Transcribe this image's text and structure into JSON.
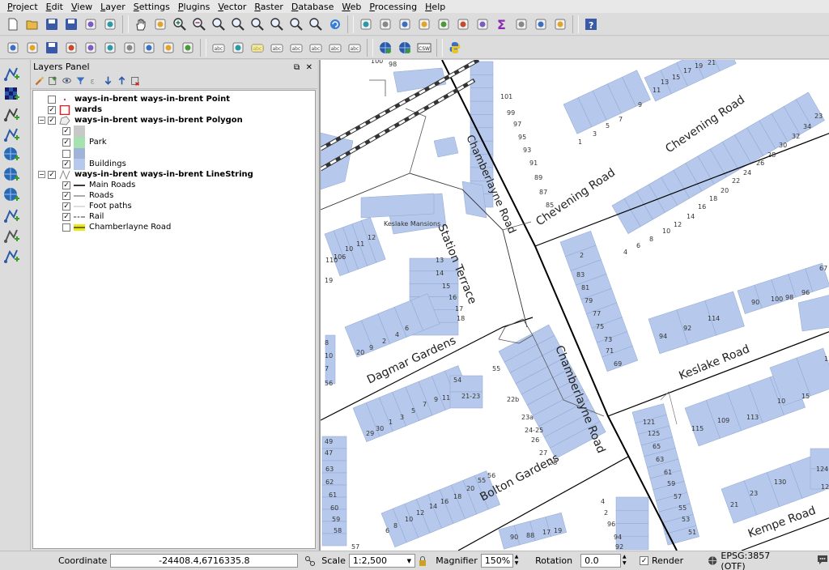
{
  "menu": [
    "Project",
    "Edit",
    "View",
    "Layer",
    "Settings",
    "Plugins",
    "Vector",
    "Raster",
    "Database",
    "Web",
    "Processing",
    "Help"
  ],
  "toolbar1": [
    "new-project-icon",
    "open-project-icon",
    "save-project-icon",
    "save-as-icon",
    "new-print-layout-icon",
    "print-composer-manager-icon",
    "|",
    "pan-icon",
    "pan-to-selection-icon",
    "zoom-in-icon",
    "zoom-out-icon",
    "zoom-actual-icon",
    "zoom-full-icon",
    "zoom-to-selection-icon",
    "zoom-to-layer-icon",
    "zoom-last-icon",
    "zoom-next-icon",
    "refresh-icon",
    "|",
    "identify-icon",
    "select-features-icon",
    "select-polygon-icon",
    "deselect-icon",
    "field-calculator-icon",
    "attribute-table-icon",
    "statistics-icon",
    "sum-icon",
    "measure-icon",
    "map-tips-icon",
    "text-annotation-icon",
    "|",
    "help-icon"
  ],
  "toolbar2": [
    "toggle-editing-icon",
    "current-edits-icon",
    "save-edits-icon",
    "add-feature-icon",
    "move-feature-icon",
    "node-tool-icon",
    "delete-selected-icon",
    "cut-features-icon",
    "copy-features-icon",
    "paste-features-icon",
    "|",
    "label-tool-icon",
    "style-manager-icon",
    "layer-labeling-icon",
    "pin-labels-icon",
    "highlight-labels-icon",
    "move-label-icon",
    "rotate-label-icon",
    "change-label-icon",
    "|",
    "metasearch-icon",
    "wms-search-icon",
    "csw-icon",
    "|",
    "python-console-icon"
  ],
  "sidebar_tools": [
    "add-vector-layer-icon",
    "add-raster-layer-icon",
    "add-spatialite-layer-icon",
    "add-postgis-layer-icon",
    "add-wms-layer-icon",
    "add-wfs-layer-icon",
    "add-wcs-layer-icon",
    "add-delimited-text-icon",
    "add-gpx-layer-icon",
    "new-shapefile-icon"
  ],
  "layers_panel": {
    "title": "Layers Panel",
    "layers": [
      {
        "name": "ways-in-brent ways-in-brent Point",
        "checked": false,
        "bold": true,
        "symbol": "point",
        "indent": 0
      },
      {
        "name": "wards",
        "checked": true,
        "bold": true,
        "symbol": "red-outline",
        "indent": 0
      },
      {
        "name": "ways-in-brent ways-in-brent Polygon",
        "checked": true,
        "bold": true,
        "symbol": "polygon",
        "indent": 0,
        "expander": "−"
      },
      {
        "name": "",
        "checked": true,
        "bold": false,
        "symbol": "grey-fill",
        "indent": 1
      },
      {
        "name": "Park",
        "checked": true,
        "bold": false,
        "symbol": "green-fill",
        "indent": 1
      },
      {
        "name": "",
        "checked": false,
        "bold": false,
        "symbol": "steel-fill",
        "indent": 1
      },
      {
        "name": "Buildings",
        "checked": true,
        "bold": false,
        "symbol": "blue-fill",
        "indent": 1
      },
      {
        "name": "ways-in-brent ways-in-brent LineString",
        "checked": true,
        "bold": true,
        "symbol": "line",
        "indent": 0,
        "expander": "−"
      },
      {
        "name": "Main Roads",
        "checked": true,
        "bold": false,
        "symbol": "thick-line",
        "indent": 1
      },
      {
        "name": "Roads",
        "checked": true,
        "bold": false,
        "symbol": "thin-line",
        "indent": 1
      },
      {
        "name": "Foot paths",
        "checked": true,
        "bold": false,
        "symbol": "faint-line",
        "indent": 1
      },
      {
        "name": "Rail",
        "checked": true,
        "bold": false,
        "symbol": "rail-line",
        "indent": 1
      },
      {
        "name": "Chamberlayne Road",
        "checked": false,
        "bold": false,
        "symbol": "yellow-line",
        "indent": 1
      }
    ]
  },
  "map": {
    "street_labels": [
      "Chamberlayne Road",
      "Chevening Road",
      "Chevening Road",
      "Station Terrace",
      "Chamberlayne Road",
      "Dagmar Gardens",
      "Keslake Road",
      "Bolton Gardens",
      "Kempe Road"
    ],
    "place_labels": [
      "Keslake Mansions"
    ],
    "house_numbers": [
      "100",
      "98",
      "101",
      "99",
      "97",
      "95",
      "93",
      "91",
      "89",
      "87",
      "85",
      "1",
      "3",
      "5",
      "7",
      "9",
      "11",
      "13",
      "15",
      "17",
      "19",
      "21",
      "23",
      "34",
      "32",
      "30",
      "28",
      "26",
      "24",
      "22",
      "20",
      "18",
      "16",
      "14",
      "12",
      "10",
      "8",
      "6",
      "4",
      "2",
      "83",
      "81",
      "79",
      "77",
      "75",
      "73",
      "71",
      "69",
      "67",
      "90",
      "100",
      "98",
      "96",
      "94",
      "92",
      "114",
      "110",
      "106",
      "10",
      "11",
      "12",
      "13",
      "14",
      "15",
      "16",
      "17",
      "18",
      "19",
      "20",
      "9",
      "2",
      "4",
      "6",
      "8",
      "10",
      "7",
      "56",
      "55",
      "54",
      "21-23",
      "22b",
      "23a",
      "24-25",
      "26",
      "27",
      "28",
      "29",
      "30",
      "1",
      "3",
      "5",
      "7",
      "9",
      "11",
      "13",
      "15",
      "10",
      "113",
      "109",
      "115",
      "121",
      "125",
      "65",
      "63",
      "61",
      "59",
      "57",
      "55",
      "53",
      "51",
      "49",
      "47",
      "63",
      "62",
      "61",
      "60",
      "59",
      "58",
      "57",
      "56",
      "55",
      "20",
      "18",
      "16",
      "14",
      "12",
      "10",
      "8",
      "6",
      "4",
      "2",
      "96",
      "94",
      "92",
      "90",
      "88",
      "17",
      "19",
      "21",
      "23",
      "130",
      "124",
      "120",
      "118",
      "11"
    ],
    "colors": {
      "building": "#b6c9ec",
      "road": "#000000",
      "minor_road": "#555555",
      "rail": "#333333"
    }
  },
  "status": {
    "coordinate_label": "Coordinate",
    "coordinate_value": "-24408.4,6716335.8",
    "scale_label": "Scale",
    "scale_value": "1:2,500",
    "magnifier_label": "Magnifier",
    "magnifier_value": "150%",
    "rotation_label": "Rotation",
    "rotation_value": "0.0",
    "render_label": "Render",
    "render_checked": "✓",
    "crs_label": "EPSG:3857 (OTF)"
  }
}
